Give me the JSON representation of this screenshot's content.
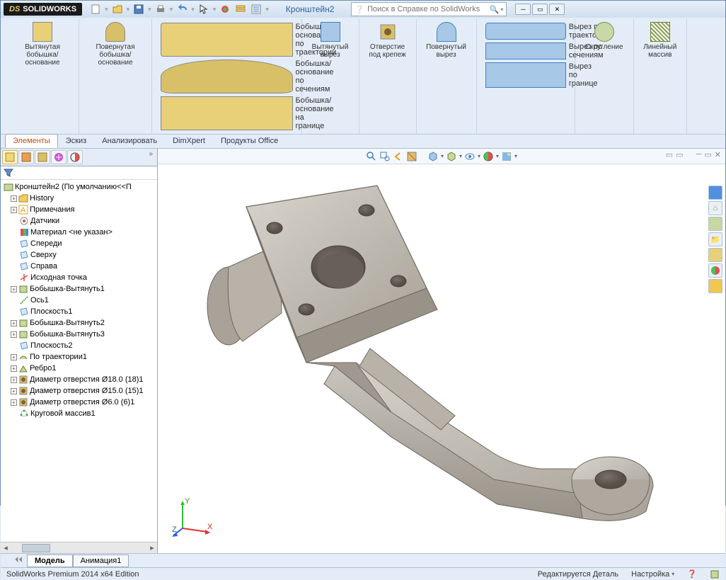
{
  "app": {
    "name": "SOLIDWORKS",
    "ds": "DS"
  },
  "document": {
    "title": "Кронштейн2"
  },
  "search": {
    "placeholder": "Поиск в Справке по SolidWorks"
  },
  "ribbon": {
    "boss_extrude": "Вытянутая бобышка/основание",
    "boss_revolve": "Повернутая бобышка/основание",
    "sweep": "Бобышка/основание по траектории",
    "loft": "Бобышка/основание по сечениям",
    "boundary": "Бобышка/основание на границе",
    "cut_extrude": "Вытянутый вырез",
    "hole_wizard": "Отверстие под крепеж",
    "cut_revolve": "Повернутый вырез",
    "cut_sweep": "Вырез по траектории",
    "cut_loft": "Вырез по сечениям",
    "cut_boundary": "Вырез по границе",
    "fillet": "Скругление",
    "linear_pattern": "Линейный массив"
  },
  "tabs": [
    "Элементы",
    "Эскиз",
    "Анализировать",
    "DimXpert",
    "Продукты Office"
  ],
  "tree": {
    "root": "Кронштейн2  (По умолчанию<<П",
    "items": [
      "History",
      "Примечания",
      "Датчики",
      "Материал <не указан>",
      "Спереди",
      "Сверху",
      "Справа",
      "Исходная точка",
      "Бобышка-Вытянуть1",
      "Ось1",
      "Плоскость1",
      "Бобышка-Вытянуть2",
      "Бобышка-Вытянуть3",
      "Плоскость2",
      "По траектории1",
      "Ребро1",
      "Диаметр отверстия Ø18.0 (18)1",
      "Диаметр отверстия Ø15.0 (15)1",
      "Диаметр отверстия Ø6.0 (6)1",
      "Круговой массив1"
    ]
  },
  "bottom_tabs": [
    "Модель",
    "Анимация1"
  ],
  "status": {
    "left": "SolidWorks Premium 2014 x64 Edition",
    "mode": "Редактируется Деталь",
    "custom": "Настройка"
  },
  "triad": {
    "x": "X",
    "y": "Y",
    "z": "Z"
  }
}
